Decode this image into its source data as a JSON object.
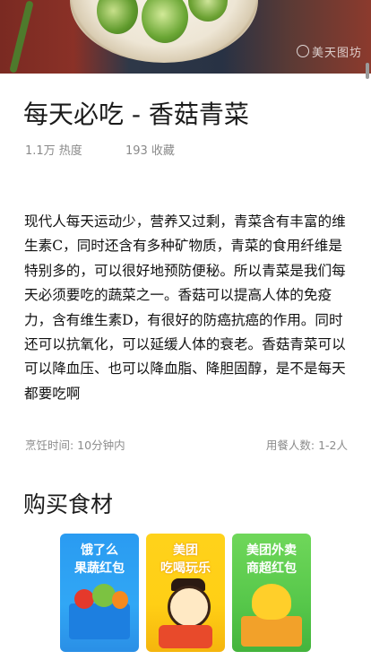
{
  "hero": {
    "watermark": "美天图坊",
    "image_alt": "bok choy with mushrooms on plate"
  },
  "recipe": {
    "title": "每天必吃 - 香菇青菜",
    "heat": "1.1万 热度",
    "favorites": "193 收藏",
    "description": "现代人每天运动少，营养又过剩，青菜含有丰富的维生素C，同时还含有多种矿物质，青菜的食用纤维是特别多的，可以很好地预防便秘。所以青菜是我们每天必须要吃的蔬菜之一。香菇可以提高人体的免疫力，含有维生素D，有很好的防癌抗癌的作用。同时还可以抗氧化，可以延缓人体的衰老。香菇青菜可以可以降血压、也可以降血脂、降胆固醇，是不是每天都要吃啊",
    "cook_time": "烹饪时间: 10分钟内",
    "servings": "用餐人数: 1-2人"
  },
  "shopping": {
    "section_title": "购买食材",
    "cards": [
      {
        "title": "饿了么\n果蔬红包",
        "color": "#2a9bf1"
      },
      {
        "title": "美团\n吃喝玩乐",
        "color": "#ffd21b"
      },
      {
        "title": "美团外卖\n商超红包",
        "color": "#56c74a"
      }
    ]
  }
}
